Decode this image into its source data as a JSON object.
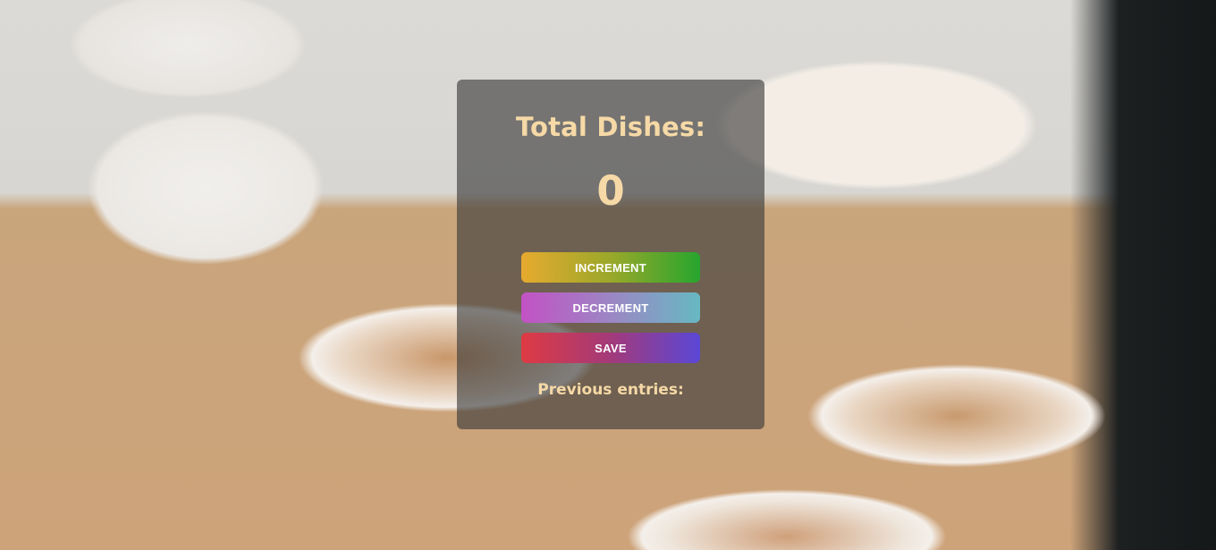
{
  "counter": {
    "title": "Total Dishes:",
    "value": "0"
  },
  "buttons": {
    "increment_label": "INCREMENT",
    "decrement_label": "DECREMENT",
    "save_label": "SAVE"
  },
  "entries": {
    "heading": "Previous entries:",
    "items": []
  },
  "colors": {
    "text_accent": "#f6d9a6",
    "panel": "rgba(55,55,55,0.62)"
  }
}
